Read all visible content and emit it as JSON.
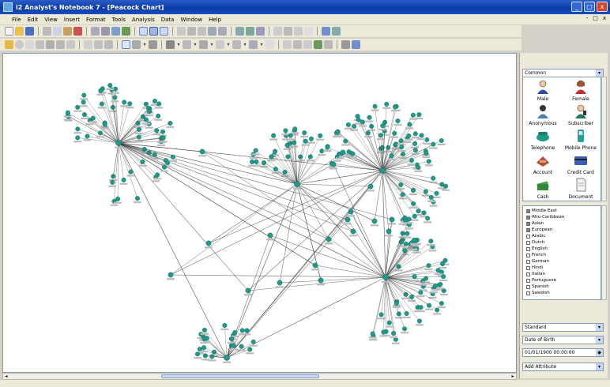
{
  "window": {
    "title": "i2 Analyst's Notebook 7 - [Peacock Chart]",
    "min_label": "_",
    "max_label": "□",
    "close_label": "x"
  },
  "menu": [
    "File",
    "Edit",
    "View",
    "Insert",
    "Format",
    "Tools",
    "Analysis",
    "Data",
    "Window",
    "Help"
  ],
  "mdi_controls": [
    "-",
    "□",
    "x"
  ],
  "palette": {
    "category": "Common",
    "items": [
      {
        "label": "Male",
        "icon": "male-person-icon"
      },
      {
        "label": "Female",
        "icon": "female-person-icon"
      },
      {
        "label": "Anonymous",
        "icon": "anonymous-person-icon"
      },
      {
        "label": "Subscriber",
        "icon": "subscriber-icon"
      },
      {
        "label": "Telephone",
        "icon": "telephone-icon"
      },
      {
        "label": "Mobile Phone",
        "icon": "mobile-phone-icon"
      },
      {
        "label": "Account",
        "icon": "account-icon"
      },
      {
        "label": "Credit Card",
        "icon": "credit-card-icon"
      },
      {
        "label": "Cash",
        "icon": "cash-icon"
      },
      {
        "label": "Document",
        "icon": "document-icon"
      }
    ]
  },
  "attribute_list": [
    {
      "label": "Middle East",
      "checked": true
    },
    {
      "label": "Afro-Caribbean",
      "checked": true
    },
    {
      "label": "Asian",
      "checked": true
    },
    {
      "label": "European",
      "checked": true
    },
    {
      "label": "Arabic",
      "checked": false
    },
    {
      "label": "Dutch",
      "checked": false
    },
    {
      "label": "English",
      "checked": false
    },
    {
      "label": "French",
      "checked": false
    },
    {
      "label": "German",
      "checked": false
    },
    {
      "label": "Hindi",
      "checked": false
    },
    {
      "label": "Italian",
      "checked": false
    },
    {
      "label": "Portuguese",
      "checked": false
    },
    {
      "label": "Spanish",
      "checked": false
    },
    {
      "label": "Swedish",
      "checked": false
    }
  ],
  "properties": {
    "style": "Standard",
    "attribute": "Date of Birth",
    "date_value": "01/01/1900 00:00:00",
    "add_label": "Add Attribute"
  },
  "colors": {
    "node": "#1f9a8a",
    "link": "#3b3b3b",
    "canvas": "#ffffff",
    "titlebar": "#0a3aa6"
  }
}
